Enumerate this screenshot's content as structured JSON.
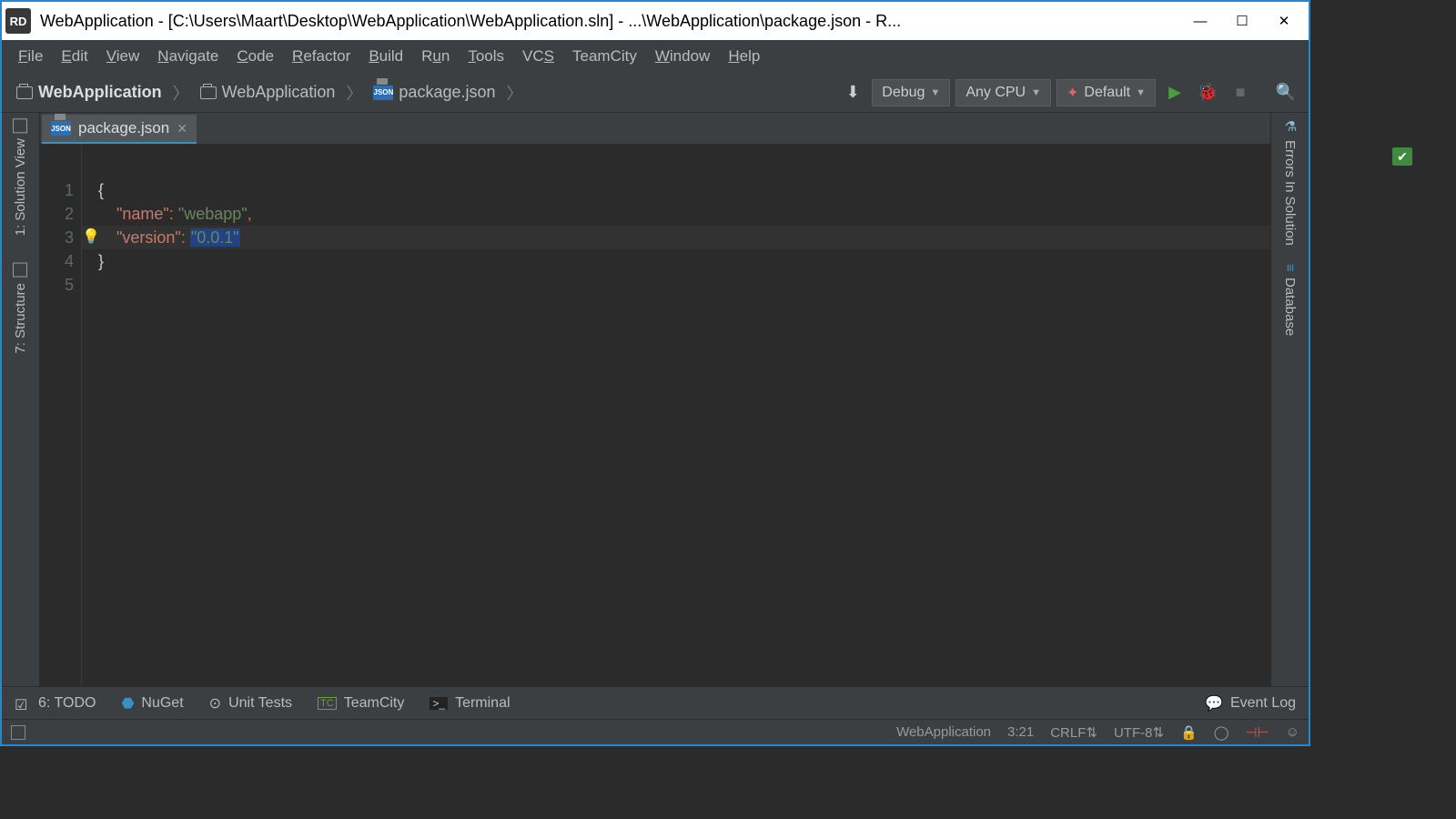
{
  "titlebar": {
    "logo": "RD",
    "title": "WebApplication - [C:\\Users\\Maart\\Desktop\\WebApplication\\WebApplication.sln] - ...\\WebApplication\\package.json - R..."
  },
  "menubar": [
    "File",
    "Edit",
    "View",
    "Navigate",
    "Code",
    "Refactor",
    "Build",
    "Run",
    "Tools",
    "VCS",
    "TeamCity",
    "Window",
    "Help"
  ],
  "breadcrumb": {
    "root": "WebApplication",
    "proj": "WebApplication",
    "file": "package.json"
  },
  "toolbar": {
    "config": "Debug",
    "platform": "Any CPU",
    "target": "Default"
  },
  "tab": {
    "name": "package.json"
  },
  "code": {
    "lines": [
      "1",
      "2",
      "3",
      "4",
      "5"
    ],
    "l1_brace": "{",
    "l2_key": "\"name\"",
    "l2_colon": ": ",
    "l2_val": "\"webapp\"",
    "l2_comma": ",",
    "l3_key": "\"version\"",
    "l3_colon": ": ",
    "l3_q1": "\"",
    "l3_val": "0.0.1",
    "l3_q2": "\"",
    "l4_brace": "}"
  },
  "left_tabs": {
    "solution": "1: Solution View",
    "structure": "7: Structure"
  },
  "right_tabs": {
    "errors": "Errors In Solution",
    "database": "Database"
  },
  "bottombar": {
    "todo": "6: TODO",
    "nuget": "NuGet",
    "unit": "Unit Tests",
    "teamcity": "TeamCity",
    "terminal": "Terminal",
    "eventlog": "Event Log"
  },
  "statusbar": {
    "context": "WebApplication",
    "pos": "3:21",
    "eol": "CRLF",
    "enc": "UTF-8"
  }
}
